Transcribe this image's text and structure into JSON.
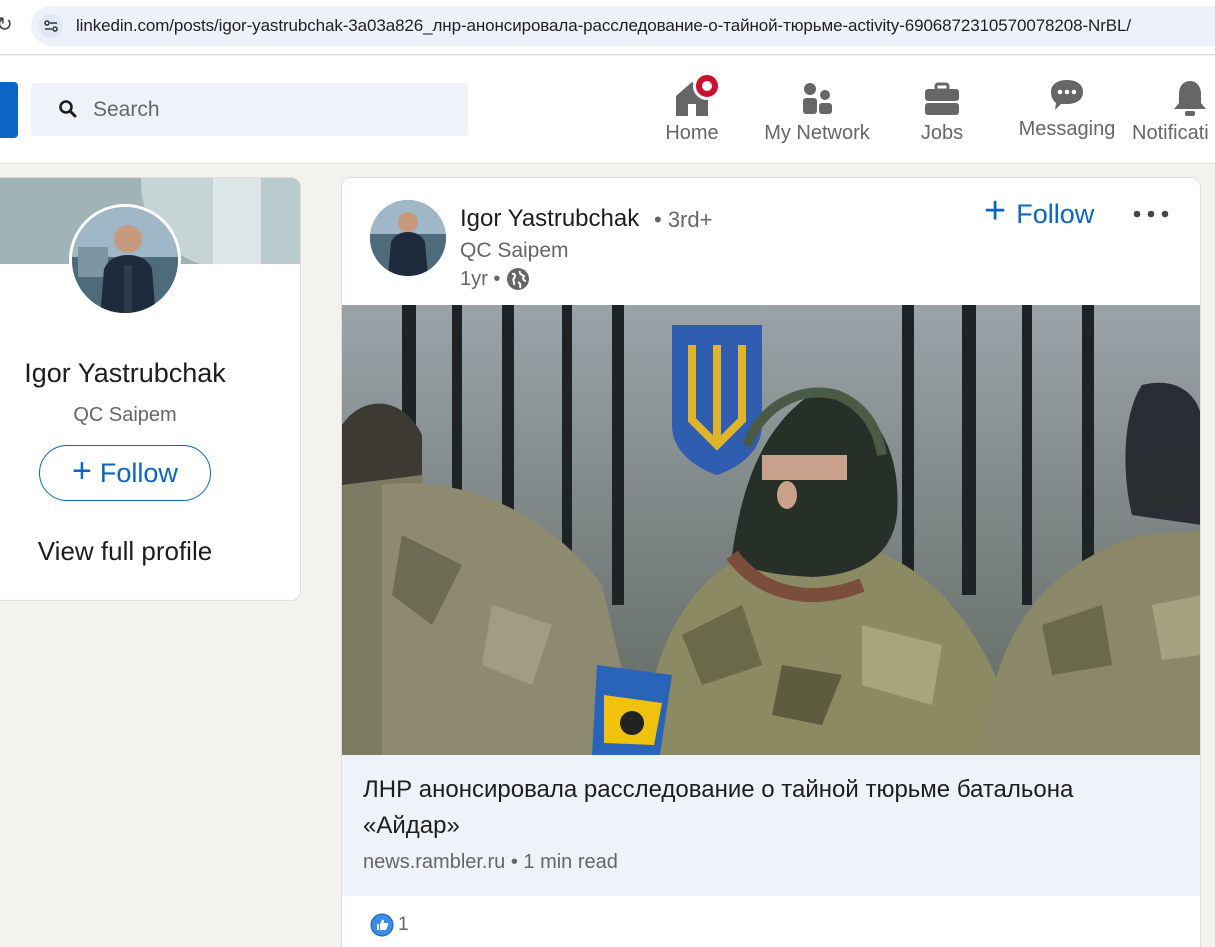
{
  "browser": {
    "url": "linkedin.com/posts/igor-yastrubchak-3a03a826_лнр-анонсировала-расследование-о-тайной-тюрьме-activity-6906872310570078208-NrBL/"
  },
  "header": {
    "search_placeholder": "Search",
    "nav": [
      {
        "label": "Home",
        "icon": "home-icon"
      },
      {
        "label": "My Network",
        "icon": "my-network-icon"
      },
      {
        "label": "Jobs",
        "icon": "jobs-icon"
      },
      {
        "label": "Messaging",
        "icon": "messaging-icon"
      },
      {
        "label": "Notificati",
        "icon": "notifications-icon"
      }
    ]
  },
  "profile_card": {
    "name": "Igor Yastrubchak",
    "company": "QC Saipem",
    "follow_label": "Follow",
    "view_profile_label": "View full profile"
  },
  "post": {
    "author": "Igor Yastrubchak",
    "degree": "• 3rd+",
    "company": "QC Saipem",
    "time": "1yr •",
    "follow_label": "Follow",
    "article_title": "ЛНР анонсировала расследование о тайной тюрьме батальона «Айдар»",
    "article_meta": "news.rambler.ru • 1 min read",
    "reaction_count": "1"
  },
  "colors": {
    "brand": "#0a66c2",
    "notification_badge": "#cb112d",
    "page_bg": "#f4f2ee"
  }
}
